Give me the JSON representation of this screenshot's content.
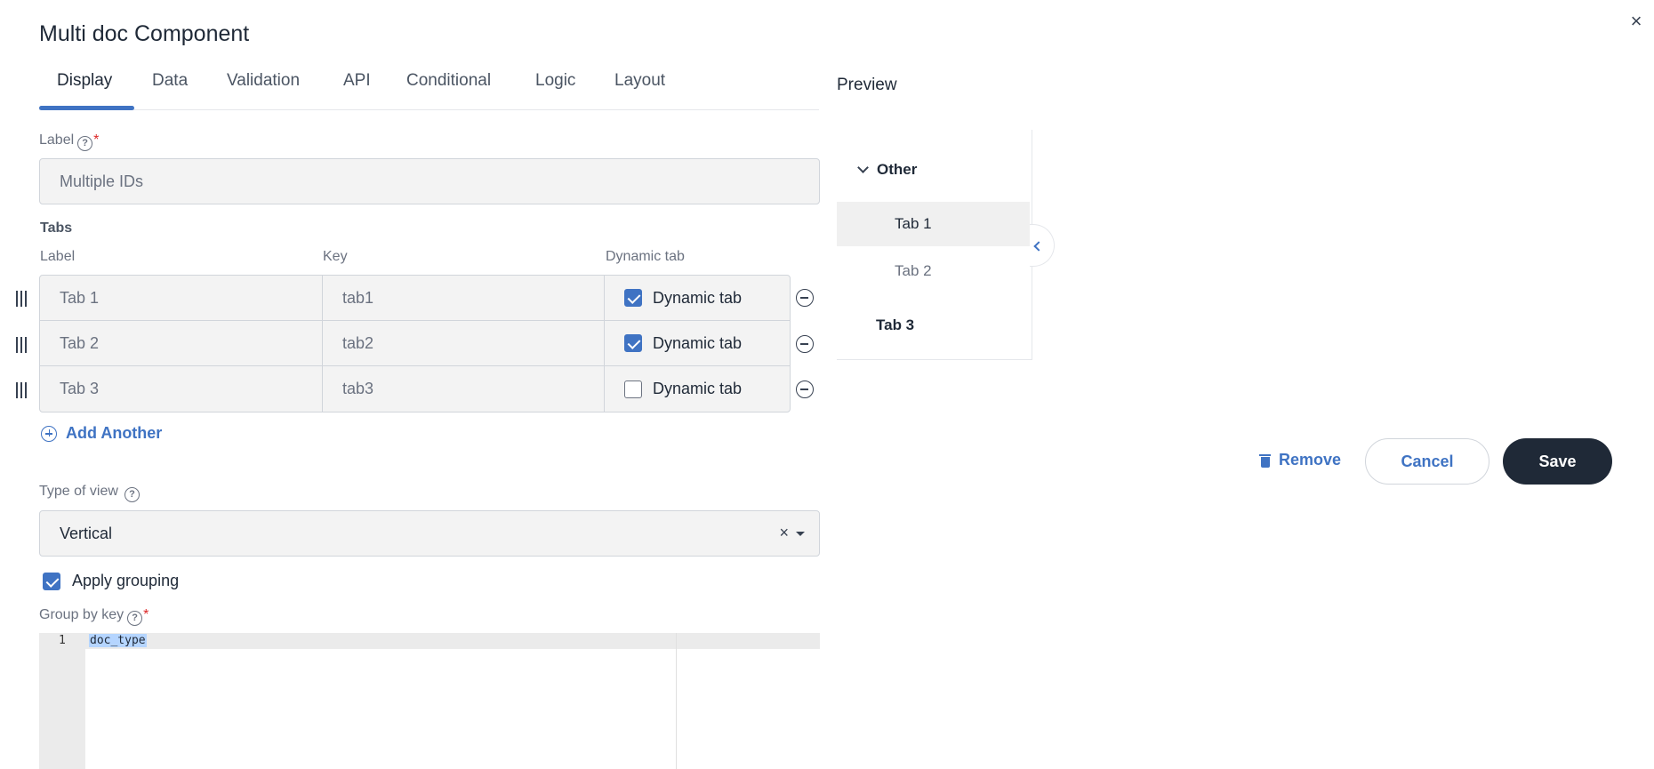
{
  "dialog": {
    "title": "Multi doc Component",
    "close_icon": "×"
  },
  "tabs": [
    {
      "label": "Display",
      "active": true
    },
    {
      "label": "Data"
    },
    {
      "label": "Validation"
    },
    {
      "label": "API"
    },
    {
      "label": "Conditional"
    },
    {
      "label": "Logic"
    },
    {
      "label": "Layout"
    }
  ],
  "label_field": {
    "label": "Label",
    "required_mark": "*",
    "help_icon": "?",
    "value": "Multiple IDs"
  },
  "tabs_grid": {
    "section_label": "Tabs",
    "headers": {
      "label": "Label",
      "key": "Key",
      "dynamic": "Dynamic tab"
    },
    "rows": [
      {
        "label": "Tab 1",
        "key": "tab1",
        "dynamic_label": "Dynamic tab",
        "dynamic": true
      },
      {
        "label": "Tab 2",
        "key": "tab2",
        "dynamic_label": "Dynamic tab",
        "dynamic": true
      },
      {
        "label": "Tab 3",
        "key": "tab3",
        "dynamic_label": "Dynamic tab",
        "dynamic": false
      }
    ],
    "add_another": "Add Another"
  },
  "type_of_view": {
    "label": "Type of view",
    "help_icon": "?",
    "value": "Vertical",
    "clear_icon": "×"
  },
  "apply_grouping": {
    "label": "Apply grouping",
    "checked": true
  },
  "group_by_key": {
    "label": "Group by key",
    "help_icon": "?",
    "required_mark": "*",
    "editor": {
      "line_number": "1",
      "code": "doc_type"
    }
  },
  "preview": {
    "title": "Preview",
    "group": "Other",
    "items": [
      {
        "label": "Tab 1",
        "selected": true
      },
      {
        "label": "Tab 2",
        "selected": false
      }
    ],
    "ungrouped": "Tab 3"
  },
  "actions": {
    "remove": "Remove",
    "cancel": "Cancel",
    "save": "Save"
  },
  "colors": {
    "accent": "#3f73c3",
    "save_bg": "#1f2937",
    "field_bg": "#f3f3f3",
    "required": "#dc2626"
  }
}
